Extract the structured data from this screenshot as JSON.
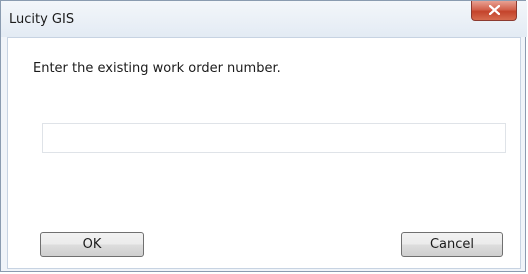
{
  "window": {
    "title": "Lucity GIS"
  },
  "dialog": {
    "prompt": "Enter the existing work order number.",
    "work_order_input": {
      "value": "",
      "placeholder": ""
    },
    "ok_label": "OK",
    "cancel_label": "Cancel"
  },
  "icons": {
    "close": "close-icon"
  },
  "colors": {
    "close_button": "#c4432b",
    "titlebar": "#e3ebf4",
    "client_background": "#ffffff"
  }
}
